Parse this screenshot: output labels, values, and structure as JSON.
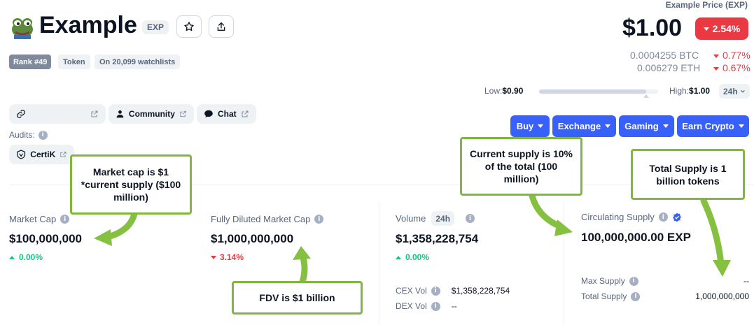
{
  "header": {
    "name": "Example",
    "symbol": "EXP",
    "price_label": "Example Price (EXP)",
    "price": "$1.00",
    "change_24h": "2.54%",
    "btc_price": "0.0004255 BTC",
    "btc_change": "0.77%",
    "eth_price": "0.006279 ETH",
    "eth_change": "0.67%"
  },
  "tags": {
    "rank": "Rank #49",
    "type": "Token",
    "watchlists": "On 20,099 watchlists"
  },
  "range": {
    "low_label": "Low:",
    "low_value": "$0.90",
    "high_label": "High:",
    "high_value": "$1.00",
    "period": "24h",
    "position_fraction": 0.9
  },
  "links": {
    "community": "Community",
    "chat": "Chat",
    "audits_label": "Audits:",
    "certik": "CertiK"
  },
  "actions": {
    "buy": "Buy",
    "exchange": "Exchange",
    "gaming": "Gaming",
    "earn": "Earn Crypto"
  },
  "stats": {
    "market_cap_label": "Market Cap",
    "market_cap_value": "$100,000,000",
    "market_cap_change": "0.00%",
    "fdv_label": "Fully Diluted Market Cap",
    "fdv_value": "$1,000,000,000",
    "fdv_change": "3.14%",
    "volume_label": "Volume",
    "volume_period": "24h",
    "volume_value": "$1,358,228,754",
    "volume_change": "0.00%",
    "cex_label": "CEX Vol",
    "cex_value": "$1,358,228,754",
    "dex_label": "DEX Vol",
    "dex_value": "--",
    "circ_label": "Circulating Supply",
    "circ_value": "100,000,000.00 EXP",
    "max_label": "Max Supply",
    "max_value": "--",
    "total_label": "Total Supply",
    "total_value": "1,000,000,000"
  },
  "annotations": {
    "market_cap_note": "Market cap is $1 *current supply ($100 million)",
    "fdv_note": "FDV is $1 billion",
    "current_supply_note": "Current supply is 10% of the total (100 million)",
    "total_supply_note": "Total Supply is 1 billion tokens"
  },
  "colors": {
    "accent": "#3861fb",
    "up": "#16c784",
    "down": "#ea3943",
    "annotation_border": "#7fb83a"
  }
}
